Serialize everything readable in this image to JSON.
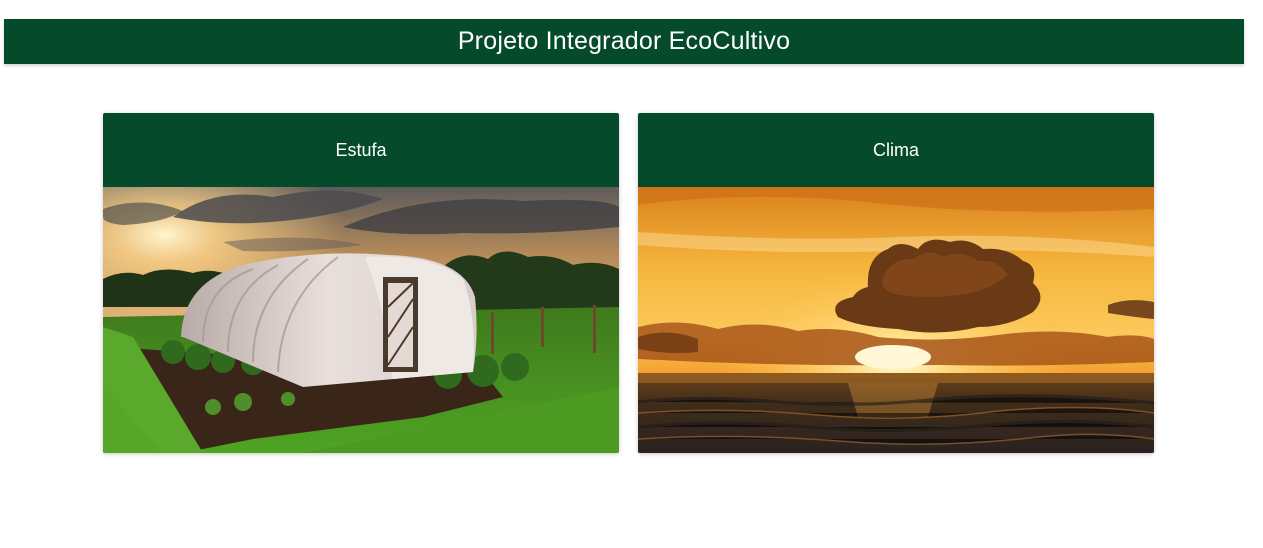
{
  "header": {
    "title": "Projeto Integrador EcoCultivo"
  },
  "cards": [
    {
      "title": "Estufa",
      "image": "greenhouse-photo"
    },
    {
      "title": "Clima",
      "image": "sunset-ocean-photo"
    }
  ],
  "colors": {
    "primary": "#054b2b",
    "background": "#ffffff",
    "text_on_primary": "#ffffff"
  }
}
